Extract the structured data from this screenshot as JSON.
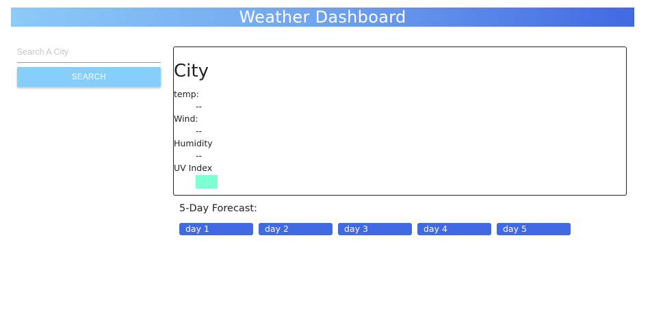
{
  "header": {
    "title": "Weather Dashboard"
  },
  "search": {
    "placeholder": "Search A City",
    "value": "",
    "button_label": "SEARCH"
  },
  "current": {
    "city": "City",
    "metrics": [
      {
        "label": "temp:",
        "value": "--"
      },
      {
        "label": "Wind:",
        "value": "--"
      },
      {
        "label": "Humidity",
        "value": "--"
      }
    ],
    "uv": {
      "label": "UV Index",
      "badge_color": "#7fffd4"
    }
  },
  "forecast": {
    "title": "5-Day Forecast:",
    "days": [
      "day 1",
      "day 2",
      "day 3",
      "day 4",
      "day 5"
    ]
  },
  "colors": {
    "header_gradient_start": "#8ccaf7",
    "header_gradient_end": "#4169e1",
    "search_button": "#87cefa",
    "forecast_card": "#4169e1"
  }
}
